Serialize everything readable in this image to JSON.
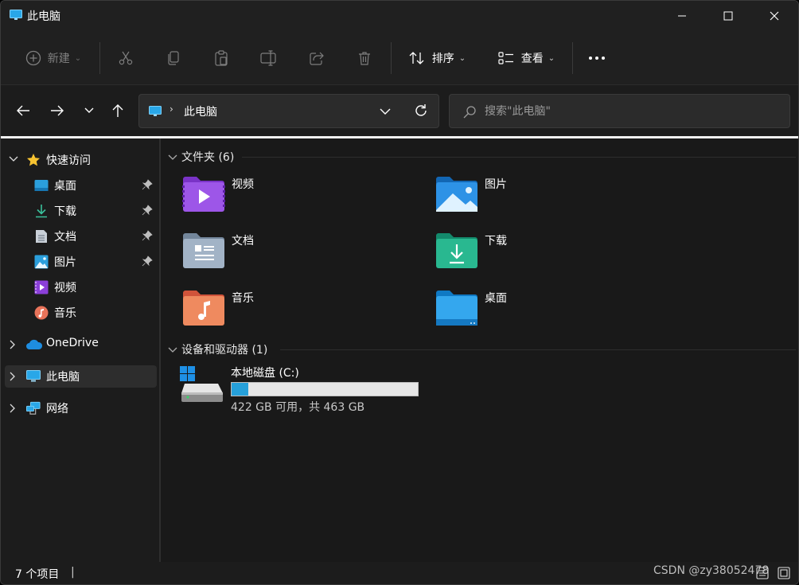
{
  "window": {
    "title": "此电脑",
    "accent_color": "#26a0da",
    "background": "#1f1f1f"
  },
  "toolbar": {
    "new_label": "新建",
    "cut_label": "剪切",
    "copy_label": "复制",
    "paste_label": "粘贴",
    "rename_label": "重命名",
    "share_label": "共享",
    "delete_label": "删除",
    "sort_label": "排序",
    "view_label": "查看",
    "more_icon": "more-icon"
  },
  "address": {
    "path": "此电脑"
  },
  "search": {
    "placeholder": "搜索\"此电脑\""
  },
  "sidebar": {
    "quick_access": "快速访问",
    "items": [
      {
        "label": "桌面",
        "icon": "desktop-icon",
        "pinned": true
      },
      {
        "label": "下载",
        "icon": "download-icon",
        "pinned": true
      },
      {
        "label": "文档",
        "icon": "document-icon",
        "pinned": true
      },
      {
        "label": "图片",
        "icon": "pictures-icon",
        "pinned": true
      },
      {
        "label": "视频",
        "icon": "videos-icon",
        "pinned": false
      },
      {
        "label": "音乐",
        "icon": "music-icon",
        "pinned": false
      }
    ],
    "onedrive": "OneDrive",
    "this_pc": "此电脑",
    "network": "网络"
  },
  "content": {
    "folders_header": "文件夹 (6)",
    "folders": [
      {
        "label": "视频",
        "icon": "videos-folder-icon"
      },
      {
        "label": "图片",
        "icon": "pictures-folder-icon"
      },
      {
        "label": "文档",
        "icon": "documents-folder-icon"
      },
      {
        "label": "下载",
        "icon": "downloads-folder-icon"
      },
      {
        "label": "音乐",
        "icon": "music-folder-icon"
      },
      {
        "label": "桌面",
        "icon": "desktop-folder-icon"
      }
    ],
    "devices_header": "设备和驱动器 (1)",
    "drive": {
      "name": "本地磁盘 (C:)",
      "size_text": "422 GB 可用，共 463 GB",
      "used_fraction": 0.089
    }
  },
  "status": {
    "count": "7 个项目",
    "separator": "|",
    "watermark": "CSDN @zy38052478"
  }
}
